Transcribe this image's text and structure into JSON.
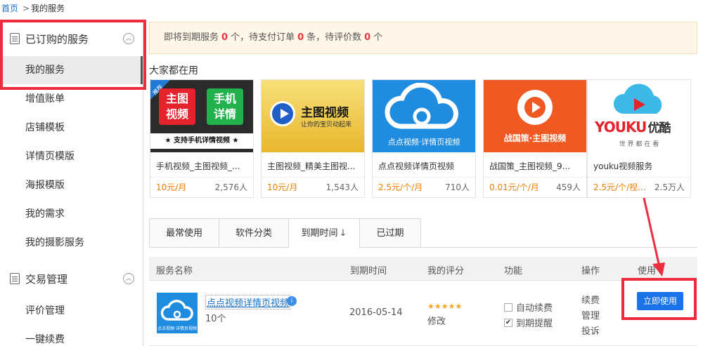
{
  "breadcrumb": {
    "home": "首页",
    "separator": ">",
    "current": "我的服务"
  },
  "sidebar": {
    "group1": {
      "label": "已订购的服务",
      "icon": "document-icon",
      "toggle": "chevron-up-icon"
    },
    "items1": [
      {
        "label": "我的服务",
        "active": true
      },
      {
        "label": "增值账单"
      },
      {
        "label": "店铺模板"
      },
      {
        "label": "详情页模版"
      },
      {
        "label": "海报模版"
      },
      {
        "label": "我的需求"
      },
      {
        "label": "我的摄影服务"
      }
    ],
    "group2": {
      "label": "交易管理",
      "icon": "list-icon",
      "toggle": "chevron-up-icon"
    },
    "items2": [
      {
        "label": "评价管理"
      },
      {
        "label": "一键续费"
      }
    ]
  },
  "notice": {
    "text1": "即将到期服务",
    "expiring": "0",
    "text2": "个，待支付订单",
    "unpaid": "0",
    "text3": "条，待评价数",
    "unrated": "0",
    "text4": "个"
  },
  "popular": {
    "title": "大家都在用",
    "cards": [
      {
        "name": "手机视频_主图视频_...",
        "price": "10元/月",
        "users": "2,576人",
        "thumb": {
          "tag": "推荐",
          "t1": "主图",
          "t2": "视频",
          "t3": "手机",
          "t4": "详情",
          "caption": "★ 支持手机详情视频 ★"
        }
      },
      {
        "name": "主图视频_精美主图视...",
        "price": "10元/月",
        "users": "1,543人",
        "thumb": {
          "title": "主图视频",
          "sub": "让你的宝贝动起来"
        }
      },
      {
        "name": "点点视频详情页视频",
        "price": "2.5元/个/月",
        "users": "710人",
        "thumb": {
          "caption": "点点视频·详情页视频"
        }
      },
      {
        "name": "战国策_主图视频_9...",
        "price": "0.01元/个/月",
        "users": "459人",
        "thumb": {
          "caption": "战国策·主图视频"
        }
      },
      {
        "name": "youku视频服务",
        "price": "2.5元/个/视...",
        "users": "2.5万人",
        "thumb": {
          "brand": "YOUKU",
          "brand_cn": "优酷",
          "slogan": "世 界 都 在 看"
        }
      }
    ]
  },
  "tabs": [
    {
      "label": "最常使用"
    },
    {
      "label": "软件分类"
    },
    {
      "label": "到期时间",
      "suffix": "↓",
      "active": true
    },
    {
      "label": "已过期"
    }
  ],
  "table": {
    "headers": {
      "name": "服务名称",
      "expire": "到期时间",
      "rating": "我的评分",
      "function": "功能",
      "operation": "操作",
      "use": "使用"
    },
    "rows": [
      {
        "name": "点点视频详情页视频",
        "quantity": "10个",
        "expire": "2016-05-14",
        "stars": "★★★★★",
        "edit": "修改",
        "auto_renew": {
          "label": "自动续费",
          "checked": false
        },
        "remind": {
          "label": "到期提醒",
          "checked": true,
          "mark": "✔"
        },
        "ops": [
          "续费",
          "管理",
          "投诉"
        ],
        "use_button": "立即使用",
        "thumb_caption": "点点视频·详情页视频",
        "badge": "i"
      }
    ]
  },
  "colors": {
    "highlight": "#ec2d3f",
    "primary": "#1a73e8",
    "price": "#f07d00",
    "notice_bg": "#fef6e9"
  }
}
